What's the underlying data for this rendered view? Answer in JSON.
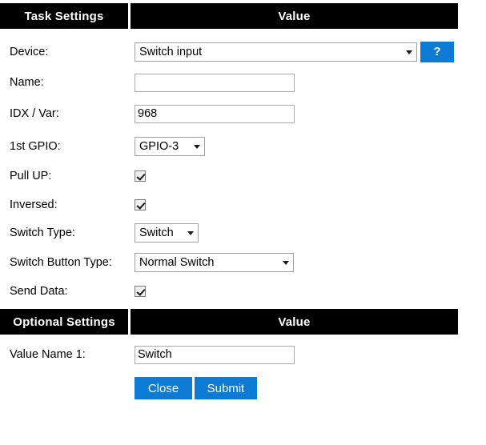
{
  "headers": {
    "task_settings": "Task Settings",
    "value_1": "Value",
    "optional_settings": "Optional Settings",
    "value_2": "Value"
  },
  "task_settings": {
    "device": {
      "label": "Device:",
      "value": "Switch input",
      "help_label": "?"
    },
    "name": {
      "label": "Name:",
      "value": "",
      "placeholder": ""
    },
    "idx_var": {
      "label": "IDX / Var:",
      "value": "968",
      "placeholder": ""
    },
    "gpio1": {
      "label": "1st GPIO:",
      "value": "GPIO-3"
    },
    "pull_up": {
      "label": "Pull UP:",
      "checked": true
    },
    "inversed": {
      "label": "Inversed:",
      "checked": true
    },
    "switch_type": {
      "label": "Switch Type:",
      "value": "Switch"
    },
    "switch_button_type": {
      "label": "Switch Button Type:",
      "value": "Normal Switch"
    },
    "send_data": {
      "label": "Send Data:",
      "checked": true
    }
  },
  "optional_settings": {
    "value_name_1": {
      "label": "Value Name 1:",
      "value": "Switch",
      "placeholder": ""
    }
  },
  "actions": {
    "close": "Close",
    "submit": "Submit"
  },
  "colors": {
    "accent_blue": "#0d7bd4",
    "header_background": "#000000",
    "header_text": "#ffffff",
    "page_background": "#ffffff",
    "field_border": "#a9a9a9"
  },
  "icons": {
    "dropdown": "chevron-down-icon",
    "checkmark": "check-icon"
  }
}
